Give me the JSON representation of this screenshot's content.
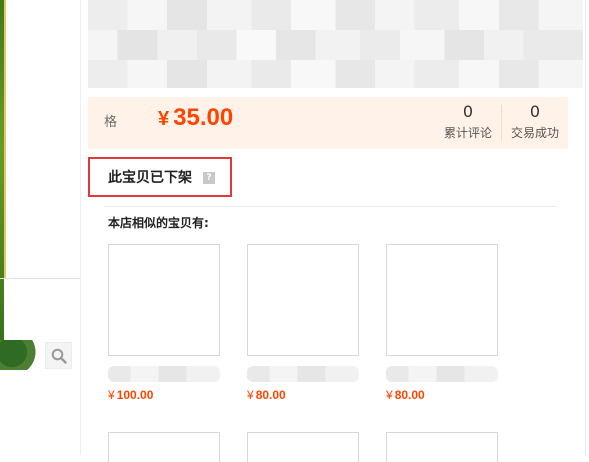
{
  "price_panel": {
    "label": "格",
    "currency": "¥",
    "price": "35.00",
    "stats": [
      {
        "value": "0",
        "label": "累计评论"
      },
      {
        "value": "0",
        "label": "交易成功"
      }
    ]
  },
  "notice": {
    "text": "此宝贝已下架",
    "help_glyph": "?"
  },
  "similar": {
    "heading": "本店相似的宝贝有:",
    "items": [
      {
        "currency": "¥",
        "price": "100.00"
      },
      {
        "currency": "¥",
        "price": "80.00"
      },
      {
        "currency": "¥",
        "price": "80.00"
      }
    ]
  },
  "icons": {
    "zoom": "magnifier-icon",
    "help": "question-mark-icon"
  },
  "colors": {
    "price": "#ff4400",
    "price_band": "#fff2e8",
    "highlight_box": "#e0393b"
  }
}
